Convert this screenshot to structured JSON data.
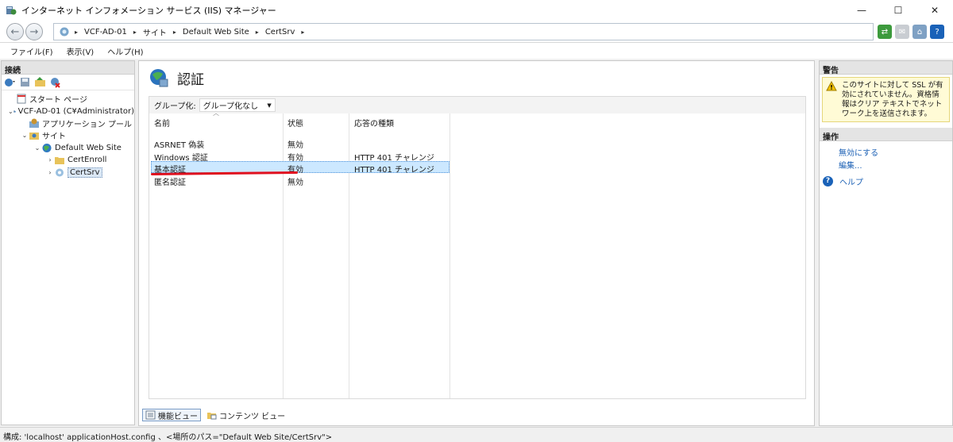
{
  "window": {
    "title": "インターネット インフォメーション サービス (IIS) マネージャー",
    "controls": {
      "minimize": "—",
      "maximize": "☐",
      "close": "✕"
    }
  },
  "address": {
    "breadcrumbs": [
      "VCF-AD-01",
      "サイト",
      "Default Web Site",
      "CertSrv"
    ],
    "separator": "▸",
    "back_icon": "arrow-left-icon",
    "forward_icon": "arrow-right-icon"
  },
  "menu": [
    "ファイル(F)",
    "表示(V)",
    "ヘルプ(H)"
  ],
  "connections": {
    "header": "接続",
    "tree": [
      {
        "label": "スタート ページ",
        "icon": "start-page-icon",
        "toggle": "",
        "level": 0
      },
      {
        "label": "VCF-AD-01 (C¥Administrator)",
        "icon": "server-icon",
        "toggle": "⌄",
        "level": 0
      },
      {
        "label": "アプリケーション プール",
        "icon": "app-pool-icon",
        "toggle": "",
        "level": 1
      },
      {
        "label": "サイト",
        "icon": "sites-folder-icon",
        "toggle": "⌄",
        "level": 1
      },
      {
        "label": "Default Web Site",
        "icon": "globe-icon",
        "toggle": "⌄",
        "level": 2
      },
      {
        "label": "CertEnroll",
        "icon": "folder-icon",
        "toggle": "›",
        "level": 3
      },
      {
        "label": "CertSrv",
        "icon": "app-icon",
        "toggle": "›",
        "level": 3,
        "selected": true
      }
    ]
  },
  "feature": {
    "title": "認証",
    "group_by_label": "グループ化:",
    "group_by_value": "グループ化なし",
    "columns": [
      "名前",
      "状態",
      "応答の種類"
    ],
    "rows": [
      {
        "name": "ASRNET 偽装",
        "status": "無効",
        "response": ""
      },
      {
        "name": "Windows 認証",
        "status": "有効",
        "response": "HTTP 401 チャレンジ"
      },
      {
        "name": "基本認証",
        "status": "有効",
        "response": "HTTP 401 チャレンジ",
        "selected": true
      },
      {
        "name": "匿名認証",
        "status": "無効",
        "response": ""
      }
    ],
    "highlight_color": "#e0101e"
  },
  "view_tabs": [
    "機能ビュー",
    "コンテンツ ビュー"
  ],
  "alerts": {
    "header": "警告",
    "message": "このサイトに対して SSL が有効にされていません。資格情報はクリア テキストでネットワーク上を送信されます。"
  },
  "actions": {
    "header": "操作",
    "items": [
      "無効にする",
      "編集..."
    ],
    "help": "ヘルプ"
  },
  "status": "構成: 'localhost' applicationHost.config 、<場所のパス=\"Default Web Site/CertSrv\">"
}
